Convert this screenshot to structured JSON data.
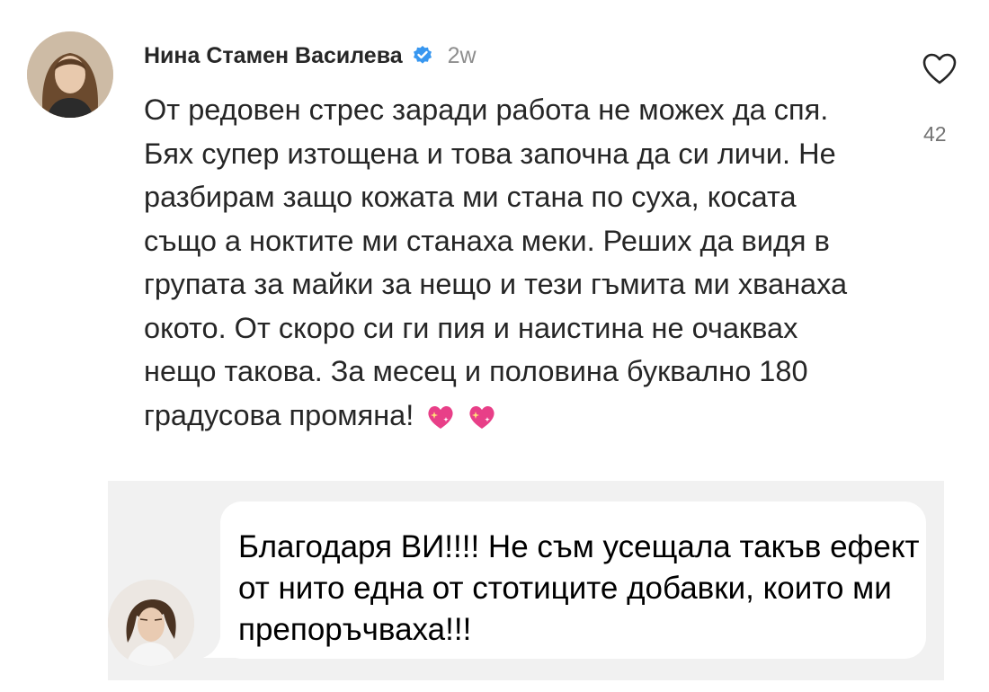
{
  "comment": {
    "author": "Нина Стамен Василева",
    "time": "2w",
    "text": "От редовен стрес заради работа не можех да спя. Бях супер изтощена и това започна да си личи. Не разбирам защо кожата ми стана по суха, косата също а ноктите ми станаха меки. Реших да видя в групата за майки за нещо и тези гъмита ми хванаха окото. От скоро си ги пия и наистина не очаквах нещо такова. За месец и половина буквално 180 градусова промяна!",
    "emoji": [
      "sparkling-heart-icon",
      "sparkling-heart-icon"
    ],
    "likes": "42",
    "verified": true
  },
  "reply": {
    "text": "Благодаря ВИ!!!! Не съм усещала такъв ефект от нито една от стотиците добавки, които ми препоръчваха!!!"
  },
  "colors": {
    "verified_badge": "#3897f0",
    "heart_emoji": "#e83f88",
    "secondary_text": "#8e8e8e",
    "reply_background": "#f1f1f1"
  }
}
